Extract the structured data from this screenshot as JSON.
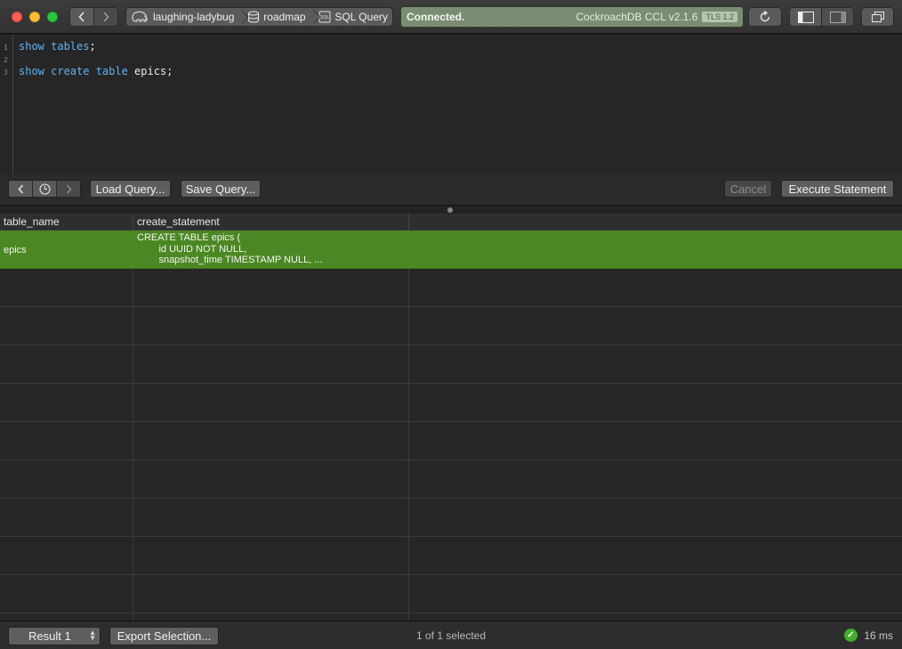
{
  "toolbar": {
    "breadcrumb": [
      "laughing-ladybug",
      "roadmap",
      "SQL Query"
    ],
    "status_text": "Connected.",
    "server_version": "CockroachDB CCL v2.1.6",
    "tls_badge": "TLS 1.2"
  },
  "editor": {
    "lines": [
      {
        "num": "1",
        "kw": "show tables",
        "rest": ";"
      },
      {
        "num": "2",
        "kw": "",
        "rest": ""
      },
      {
        "num": "3",
        "kw": "show create table",
        "rest": " epics;"
      }
    ]
  },
  "editor_bar": {
    "load_label": "Load Query...",
    "save_label": "Save Query...",
    "cancel_label": "Cancel",
    "execute_label": "Execute Statement"
  },
  "results": {
    "columns": [
      "table_name",
      "create_statement"
    ],
    "rows": [
      {
        "table_name": "epics",
        "create_statement": "CREATE TABLE epics (\n        id UUID NOT NULL,\n        snapshot_time TIMESTAMP NULL, ..."
      }
    ]
  },
  "bottom": {
    "result_select": "Result 1",
    "export_label": "Export Selection...",
    "selection_info": "1 of 1 selected",
    "timing": "16 ms"
  },
  "colors": {
    "accent_selection": "#4b8823",
    "status_bg": "#7a8d72",
    "keyword": "#5cb3f5",
    "success": "#3fae29"
  }
}
